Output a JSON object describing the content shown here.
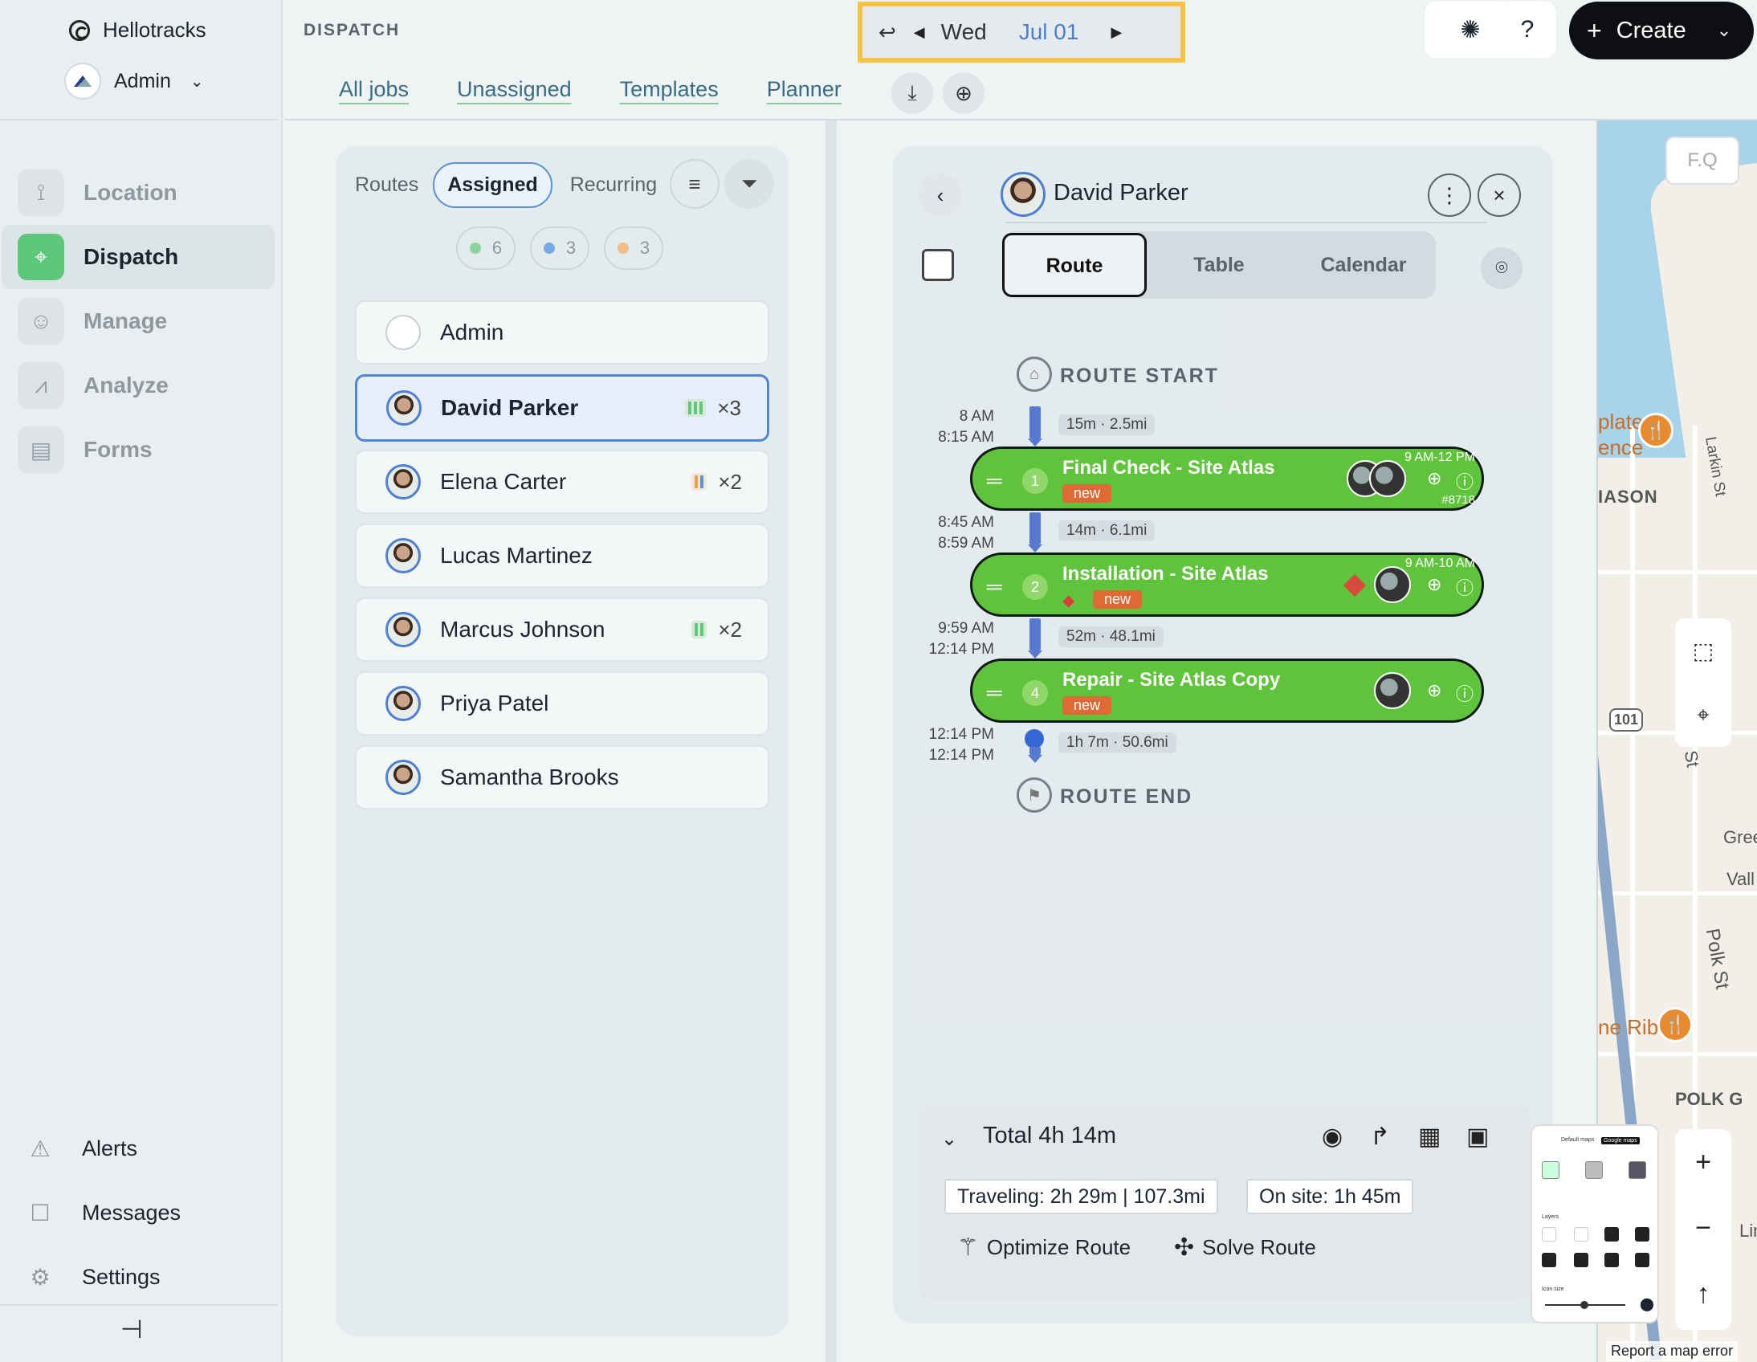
{
  "app": {
    "name": "Hellotracks",
    "account": "Admin",
    "section": "DISPATCH"
  },
  "nav": [
    {
      "label": "Location",
      "icon": "route-icon",
      "active": false
    },
    {
      "label": "Dispatch",
      "icon": "dispatch-sign-icon",
      "active": true
    },
    {
      "label": "Manage",
      "icon": "users-icon",
      "active": false
    },
    {
      "label": "Analyze",
      "icon": "chart-icon",
      "active": false
    },
    {
      "label": "Forms",
      "icon": "clipboard-icon",
      "active": false
    }
  ],
  "bottom_nav": [
    {
      "label": "Alerts",
      "icon": "alert-triangle-icon"
    },
    {
      "label": "Messages",
      "icon": "chat-icon"
    },
    {
      "label": "Settings",
      "icon": "gear-icon"
    }
  ],
  "tabs": [
    "All jobs",
    "Unassigned",
    "Templates",
    "Planner"
  ],
  "date": {
    "dow": "Wed",
    "date": "Jul 01"
  },
  "top": {
    "help": "?",
    "create": "Create"
  },
  "routes": {
    "label": "Routes",
    "assigned": "Assigned",
    "recurring": "Recurring",
    "counts": [
      {
        "value": "6",
        "color": "#8cd39b"
      },
      {
        "value": "3",
        "color": "#7aa7e6"
      },
      {
        "value": "3",
        "color": "#f0bd8a"
      }
    ],
    "users": [
      {
        "name": "Admin",
        "badge": "",
        "admin": true
      },
      {
        "name": "David Parker",
        "badge": "×3",
        "selected": true,
        "bars": [
          "#5ec77b",
          "#5ec77b",
          "#5ec77b"
        ]
      },
      {
        "name": "Elena Carter",
        "badge": "×2",
        "bars": [
          "#f0a04b",
          "#5a8fd8"
        ]
      },
      {
        "name": "Lucas Martinez",
        "badge": ""
      },
      {
        "name": "Marcus Johnson",
        "badge": "×2",
        "bars": [
          "#5ec77b",
          "#5ec77b"
        ]
      },
      {
        "name": "Priya Patel",
        "badge": ""
      },
      {
        "name": "Samantha Brooks",
        "badge": ""
      }
    ]
  },
  "route": {
    "worker": "David Parker",
    "views": [
      "Route",
      "Table",
      "Calendar"
    ],
    "start_label": "ROUTE START",
    "end_label": "ROUTE END",
    "legs": [
      {
        "t1": "8 AM",
        "t2": "8:15 AM",
        "info": "15m · 2.5mi"
      },
      {
        "t1": "8:45 AM",
        "t2": "8:59 AM",
        "info": "14m · 6.1mi"
      },
      {
        "t1": "9:59 AM",
        "t2": "12:14 PM",
        "info": "52m · 48.1mi"
      },
      {
        "t1": "12:14 PM",
        "t2": "12:14 PM",
        "info": "1h 7m · 50.6mi"
      }
    ],
    "jobs": [
      {
        "num": "1",
        "title": "Final Check - Site Atlas",
        "tag": "new",
        "window": "9 AM-12 PM",
        "ref": "#8718"
      },
      {
        "num": "2",
        "title": "Installation - Site Atlas",
        "tag": "new",
        "window": "9 AM-10 AM",
        "ref": ""
      },
      {
        "num": "4",
        "title": "Repair - Site Atlas Copy",
        "tag": "new",
        "window": "",
        "ref": ""
      }
    ],
    "summary": {
      "total": "Total 4h 14m",
      "traveling": "Traveling: 2h 29m | 107.3mi",
      "onsite": "On site: 1h 45m",
      "optimize": "Optimize Route",
      "solve": "Solve Route"
    }
  },
  "map": {
    "search": "F.Q",
    "labels": [
      "plate",
      "ence",
      "IASON",
      "Larkin St",
      "Gree",
      "Vall",
      "Polk St",
      "ne Rib",
      "POLK G",
      "St",
      "101",
      "Lin"
    ],
    "report": "Report a map error",
    "layers": {
      "title1": "Default maps",
      "title2": "Google maps",
      "layers": "Layers",
      "iconsize": "Icon size"
    }
  }
}
